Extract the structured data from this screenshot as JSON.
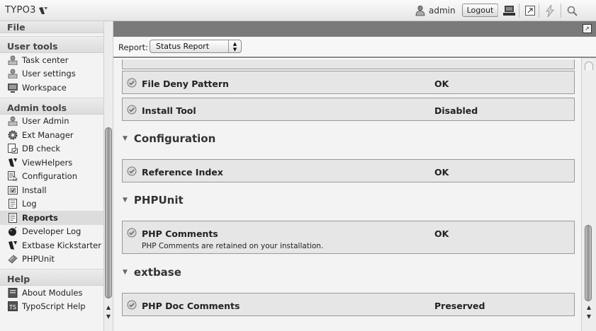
{
  "app": {
    "logo_text": "TYPO3",
    "username": "admin",
    "logout_label": "Logout"
  },
  "toolbar": {
    "icons": [
      "clear-cache-icon",
      "shortcut-icon",
      "flash-icon",
      "search-icon"
    ]
  },
  "sidebar": {
    "file_label": "File",
    "groups": [
      {
        "label": "User tools",
        "items": [
          {
            "label": "Task center",
            "icon": "user-icon"
          },
          {
            "label": "User settings",
            "icon": "user-icon"
          },
          {
            "label": "Workspace",
            "icon": "workspace-icon"
          }
        ]
      },
      {
        "label": "Admin tools",
        "items": [
          {
            "label": "User Admin",
            "icon": "user-icon"
          },
          {
            "label": "Ext Manager",
            "icon": "gear-icon"
          },
          {
            "label": "DB check",
            "icon": "db-check-icon"
          },
          {
            "label": "ViewHelpers",
            "icon": "typo3-icon"
          },
          {
            "label": "Configuration",
            "icon": "configuration-icon"
          },
          {
            "label": "Install",
            "icon": "install-icon"
          },
          {
            "label": "Log",
            "icon": "log-icon"
          },
          {
            "label": "Reports",
            "icon": "reports-icon",
            "active": true
          },
          {
            "label": "Developer Log",
            "icon": "bomb-icon"
          },
          {
            "label": "Extbase Kickstarter",
            "icon": "typo3-icon"
          },
          {
            "label": "PHPUnit",
            "icon": "phpunit-icon"
          }
        ]
      },
      {
        "label": "Help",
        "items": [
          {
            "label": "About Modules",
            "icon": "about-icon"
          },
          {
            "label": "TypoScript Help",
            "icon": "typoscript-icon"
          }
        ]
      }
    ]
  },
  "report": {
    "label": "Report:",
    "selected": "Status Report",
    "sections": [
      {
        "type": "row",
        "title": "File Deny Pattern",
        "value": "OK",
        "message": ""
      },
      {
        "type": "row",
        "title": "Install Tool",
        "value": "Disabled",
        "message": ""
      },
      {
        "type": "heading",
        "title": "Configuration"
      },
      {
        "type": "row",
        "title": "Reference Index",
        "value": "OK",
        "message": ""
      },
      {
        "type": "heading",
        "title": "PHPUnit"
      },
      {
        "type": "row",
        "title": "PHP Comments",
        "value": "OK",
        "message": "PHP Comments are retained on your installation."
      },
      {
        "type": "heading",
        "title": "extbase"
      },
      {
        "type": "row",
        "title": "PHP Doc Comments",
        "value": "Preserved",
        "message": ""
      }
    ]
  }
}
